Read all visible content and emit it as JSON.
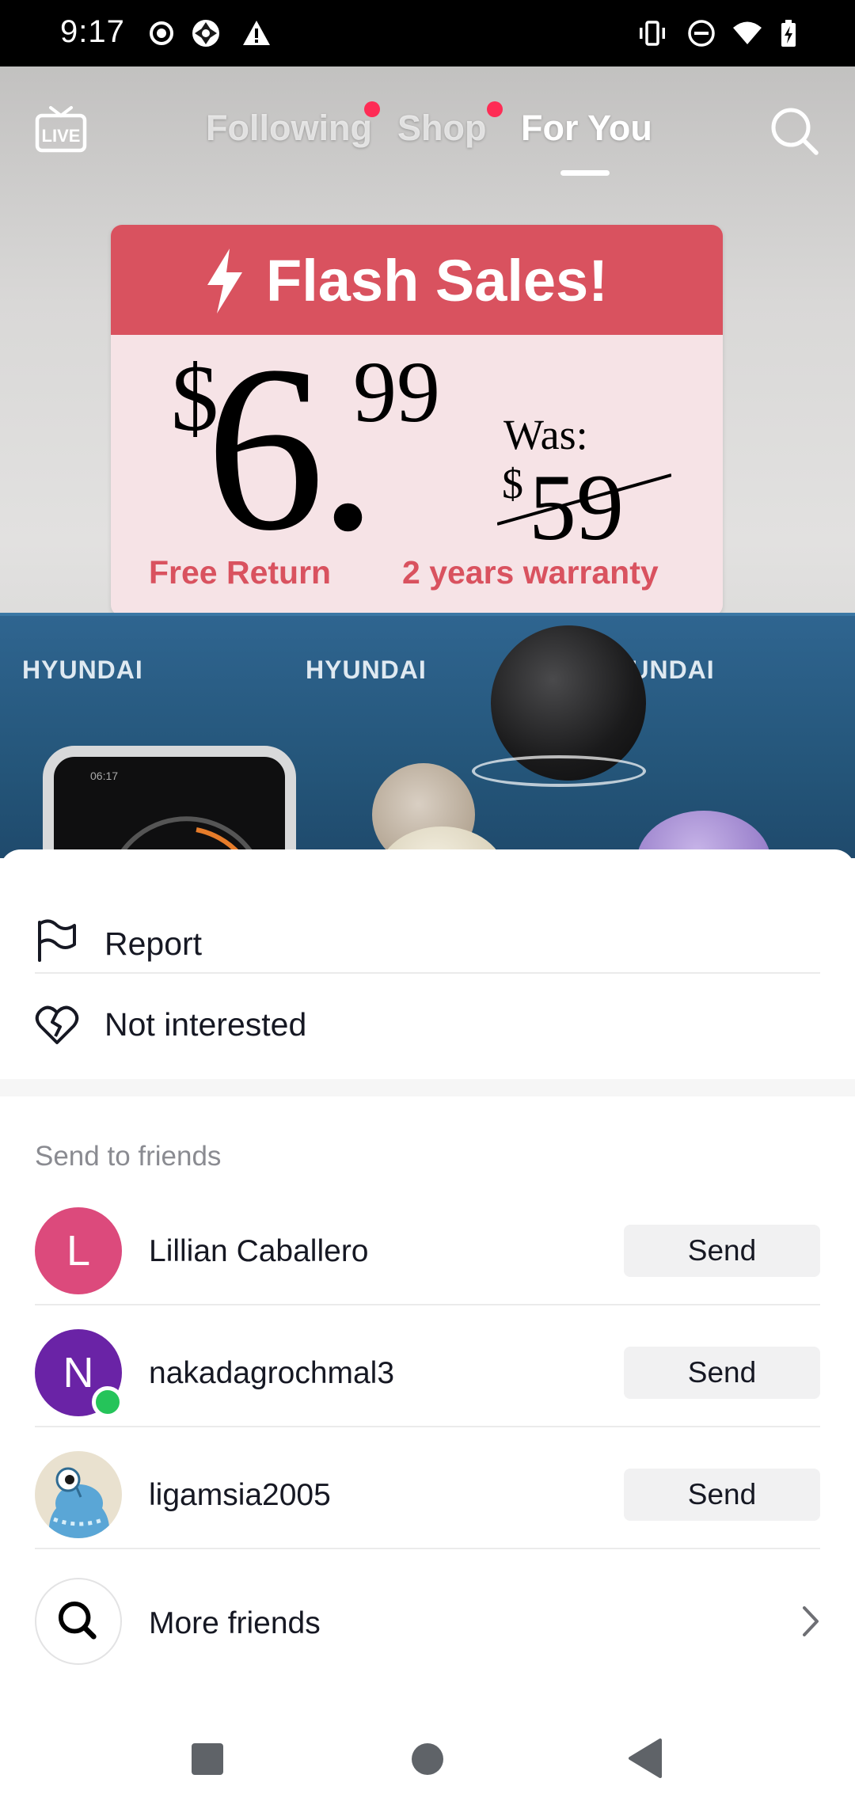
{
  "status_bar": {
    "time": "9:17",
    "left_icons": [
      "record-icon",
      "camera-shutter-icon",
      "warning-icon"
    ],
    "right_icons": [
      "vibrate-icon",
      "do-not-disturb-icon",
      "wifi-icon",
      "battery-charging-icon"
    ]
  },
  "top_nav": {
    "live_label": "LIVE",
    "tabs": [
      {
        "label": "Following",
        "has_dot": true
      },
      {
        "label": "Shop",
        "has_dot": true
      },
      {
        "label": "For You",
        "active": true
      }
    ],
    "accent_color": "#fe2c55"
  },
  "video": {
    "sign_title": "Flash Sales!",
    "price_dollar": "$",
    "price_main": "6.",
    "price_cents": "99",
    "was_label": "Was:",
    "was_dollar": "$",
    "was_price": "59",
    "footer_left": "Free Return",
    "footer_right": "2 years warranty",
    "box_brands": [
      "HYUNDAI",
      "HYUNDAI",
      "YUNDAI"
    ],
    "watch_time": "06:17"
  },
  "sheet": {
    "menu": [
      {
        "label": "Report",
        "icon": "flag-icon"
      },
      {
        "label": "Not interested",
        "icon": "broken-heart-icon"
      }
    ],
    "send_section_title": "Send to friends",
    "friends": [
      {
        "initial": "L",
        "name": "Lillian Caballero",
        "avatar_color": "#dc4a7c",
        "online": false,
        "send_label": "Send"
      },
      {
        "initial": "N",
        "name": "nakadagrochmal3",
        "avatar_color": "#6a23a6",
        "online": true,
        "send_label": "Send"
      },
      {
        "initial": "",
        "name": "ligamsia2005",
        "avatar_color": "#e9e1cf",
        "online": false,
        "send_label": "Send"
      }
    ],
    "more_friends_label": "More friends"
  },
  "nav_bar": {
    "buttons": [
      "recents-square-icon",
      "home-circle-icon",
      "back-triangle-icon"
    ]
  }
}
